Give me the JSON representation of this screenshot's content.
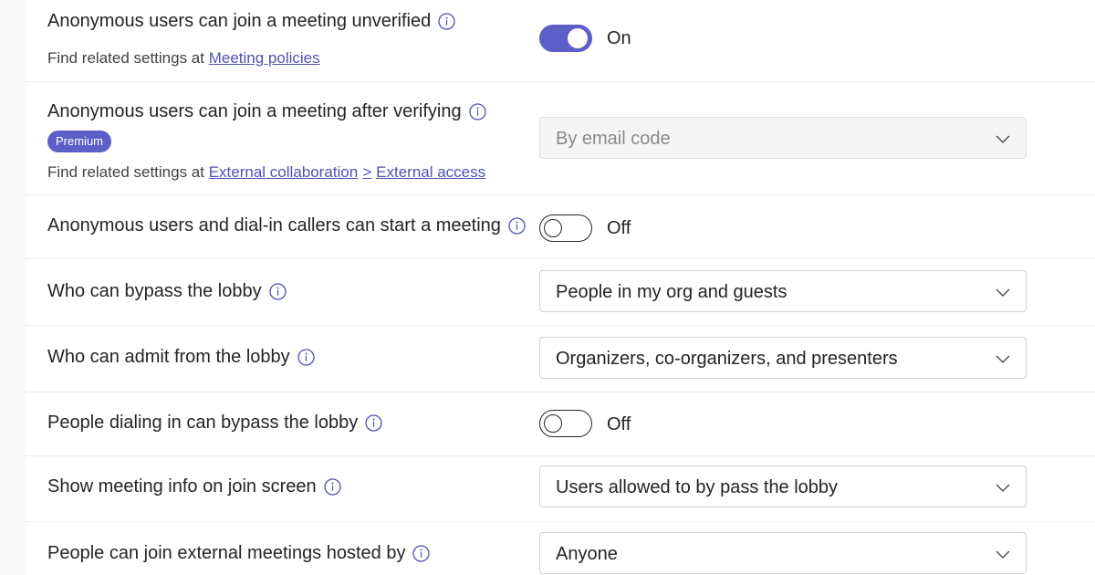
{
  "settings": {
    "anon_unverified": {
      "label": "Anonymous users can join a meeting unverified",
      "related_prefix": "Find related settings at",
      "related_link": "Meeting policies",
      "state_label": "On"
    },
    "anon_verified": {
      "label": "Anonymous users can join a meeting after verifying",
      "badge": "Premium",
      "related_prefix": "Find related settings at",
      "related_link_1": "External collaboration",
      "related_sep": ">",
      "related_link_2": "External access",
      "value": "By email code"
    },
    "anon_start": {
      "label": "Anonymous users and dial-in callers can start a meeting",
      "state_label": "Off"
    },
    "bypass_lobby": {
      "label": "Who can bypass the lobby",
      "value": "People in my org and guests"
    },
    "admit_lobby": {
      "label": "Who can admit from the lobby",
      "value": "Organizers, co-organizers, and presenters"
    },
    "dialin_bypass": {
      "label": "People dialing in can bypass the lobby",
      "state_label": "Off"
    },
    "show_info": {
      "label": "Show meeting info on join screen",
      "value": "Users allowed to by pass the lobby"
    },
    "external_meetings": {
      "label": "People can join external meetings hosted by",
      "value": "Anyone"
    }
  },
  "icons": {
    "info": "info-icon",
    "chevron": "chevron-down-icon"
  },
  "colors": {
    "accent": "#5b5fc7",
    "link": "#4f52b2",
    "text": "#242424"
  }
}
